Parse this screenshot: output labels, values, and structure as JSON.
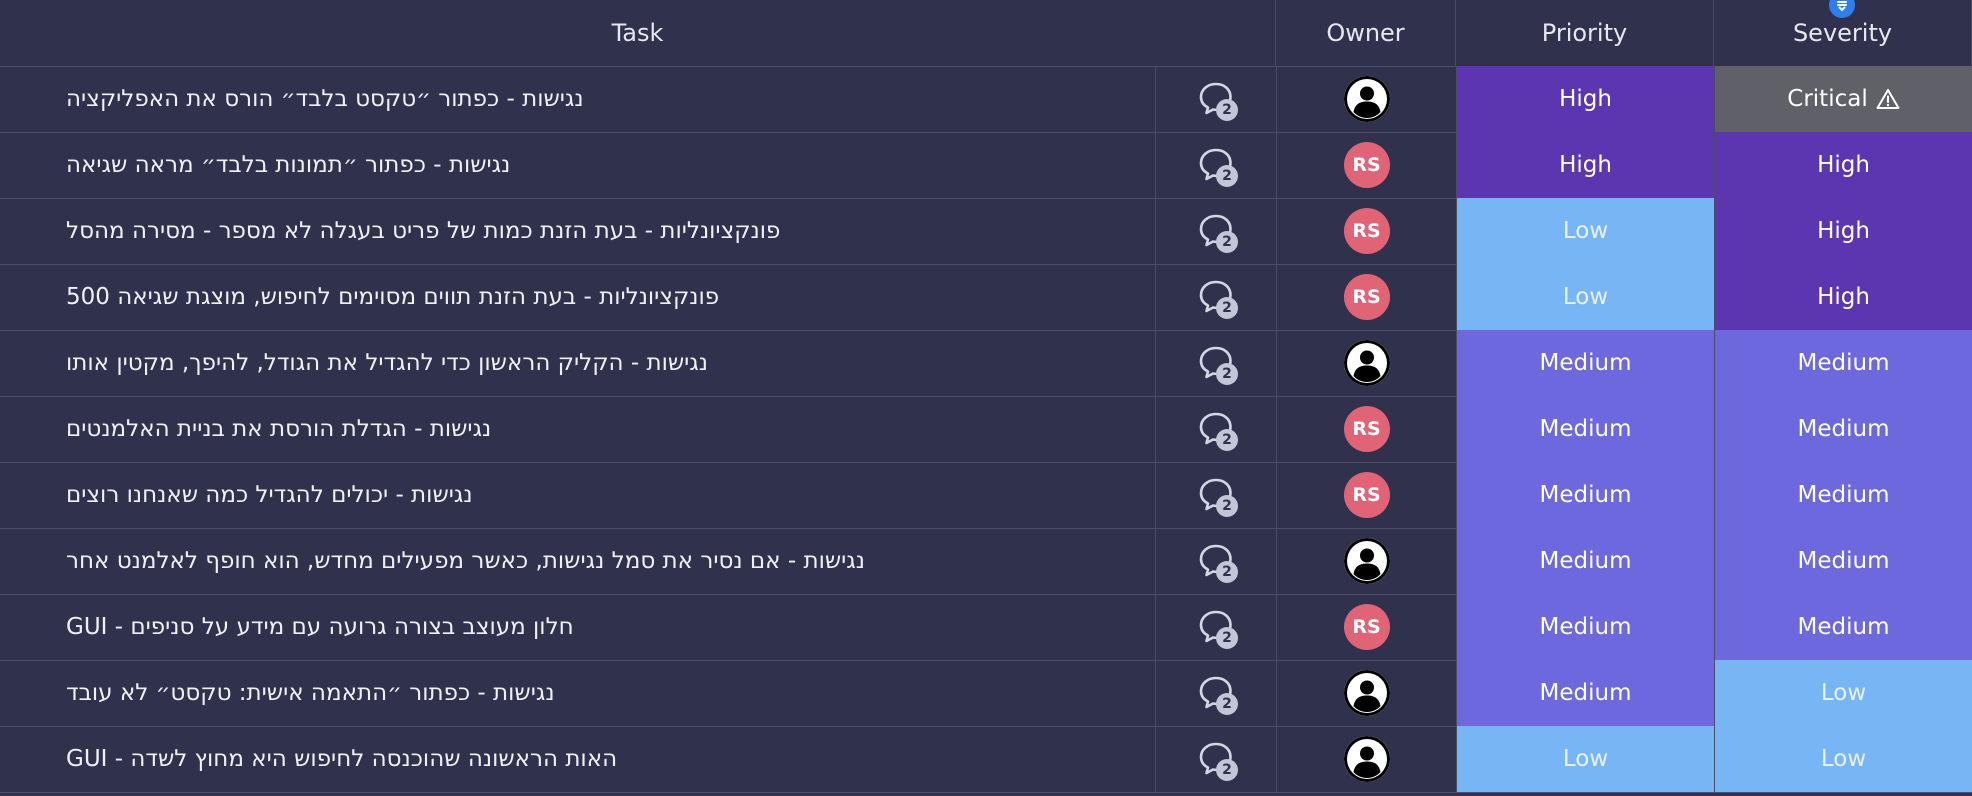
{
  "colors": {
    "background": "#30324d",
    "grid_line": "#4a4c68",
    "high": "#5c35b0",
    "critical": "#5f6068",
    "medium": "#6d68dd",
    "low": "#78b5f4",
    "low_text": "#e8f2ff",
    "avatar_initials": "#e06476",
    "sort_badge": "#2d7ff0"
  },
  "header": {
    "task": "Task",
    "owner": "Owner",
    "priority": "Priority",
    "severity": "Severity",
    "sort_icon": "sort-descending-icon"
  },
  "rows": [
    {
      "task": "נגישות - כפתור ״טקסט בלבד״ הורס את האפליקציה",
      "updates": "2",
      "owner_type": "person",
      "owner_initials": "",
      "priority": "High",
      "severity": "Critical"
    },
    {
      "task": "נגישות - כפתור ״תמונות בלבד״ מראה שגיאה",
      "updates": "2",
      "owner_type": "initials",
      "owner_initials": "RS",
      "priority": "High",
      "severity": "High"
    },
    {
      "task": "פונקציונליות - בעת הזנת כמות של פריט בעגלה לא מספר - מסירה מהסל",
      "updates": "2",
      "owner_type": "initials",
      "owner_initials": "RS",
      "priority": "Low",
      "severity": "High"
    },
    {
      "task": "פונקציונליות - בעת הזנת תווים מסוימים לחיפוש, מוצגת שגיאה 500",
      "updates": "2",
      "owner_type": "initials",
      "owner_initials": "RS",
      "priority": "Low",
      "severity": "High"
    },
    {
      "task": "נגישות - הקליק הראשון כדי להגדיל את הגודל, להיפך, מקטין אותו",
      "updates": "2",
      "owner_type": "person",
      "owner_initials": "",
      "priority": "Medium",
      "severity": "Medium"
    },
    {
      "task": "נגישות - הגדלת הורסת את בניית האלמנטים",
      "updates": "2",
      "owner_type": "initials",
      "owner_initials": "RS",
      "priority": "Medium",
      "severity": "Medium"
    },
    {
      "task": "נגישות - יכולים להגדיל כמה שאנחנו רוצים",
      "updates": "2",
      "owner_type": "initials",
      "owner_initials": "RS",
      "priority": "Medium",
      "severity": "Medium"
    },
    {
      "task": "נגישות - אם נסיר את סמל נגישות, כאשר מפעילים מחדש, הוא חופף לאלמנט אחר",
      "updates": "2",
      "owner_type": "person",
      "owner_initials": "",
      "priority": "Medium",
      "severity": "Medium"
    },
    {
      "task": "חלון מעוצב בצורה גרועה עם מידע על סניפים - GUI",
      "updates": "2",
      "owner_type": "initials",
      "owner_initials": "RS",
      "priority": "Medium",
      "severity": "Medium"
    },
    {
      "task": "נגישות - כפתור ״התאמה אישית: טקסט״ לא עובד",
      "updates": "2",
      "owner_type": "person",
      "owner_initials": "",
      "priority": "Medium",
      "severity": "Low"
    },
    {
      "task": "האות הראשונה שהוכנסה לחיפוש היא מחוץ לשדה - GUI",
      "updates": "2",
      "owner_type": "person",
      "owner_initials": "",
      "priority": "Low",
      "severity": "Low"
    }
  ]
}
